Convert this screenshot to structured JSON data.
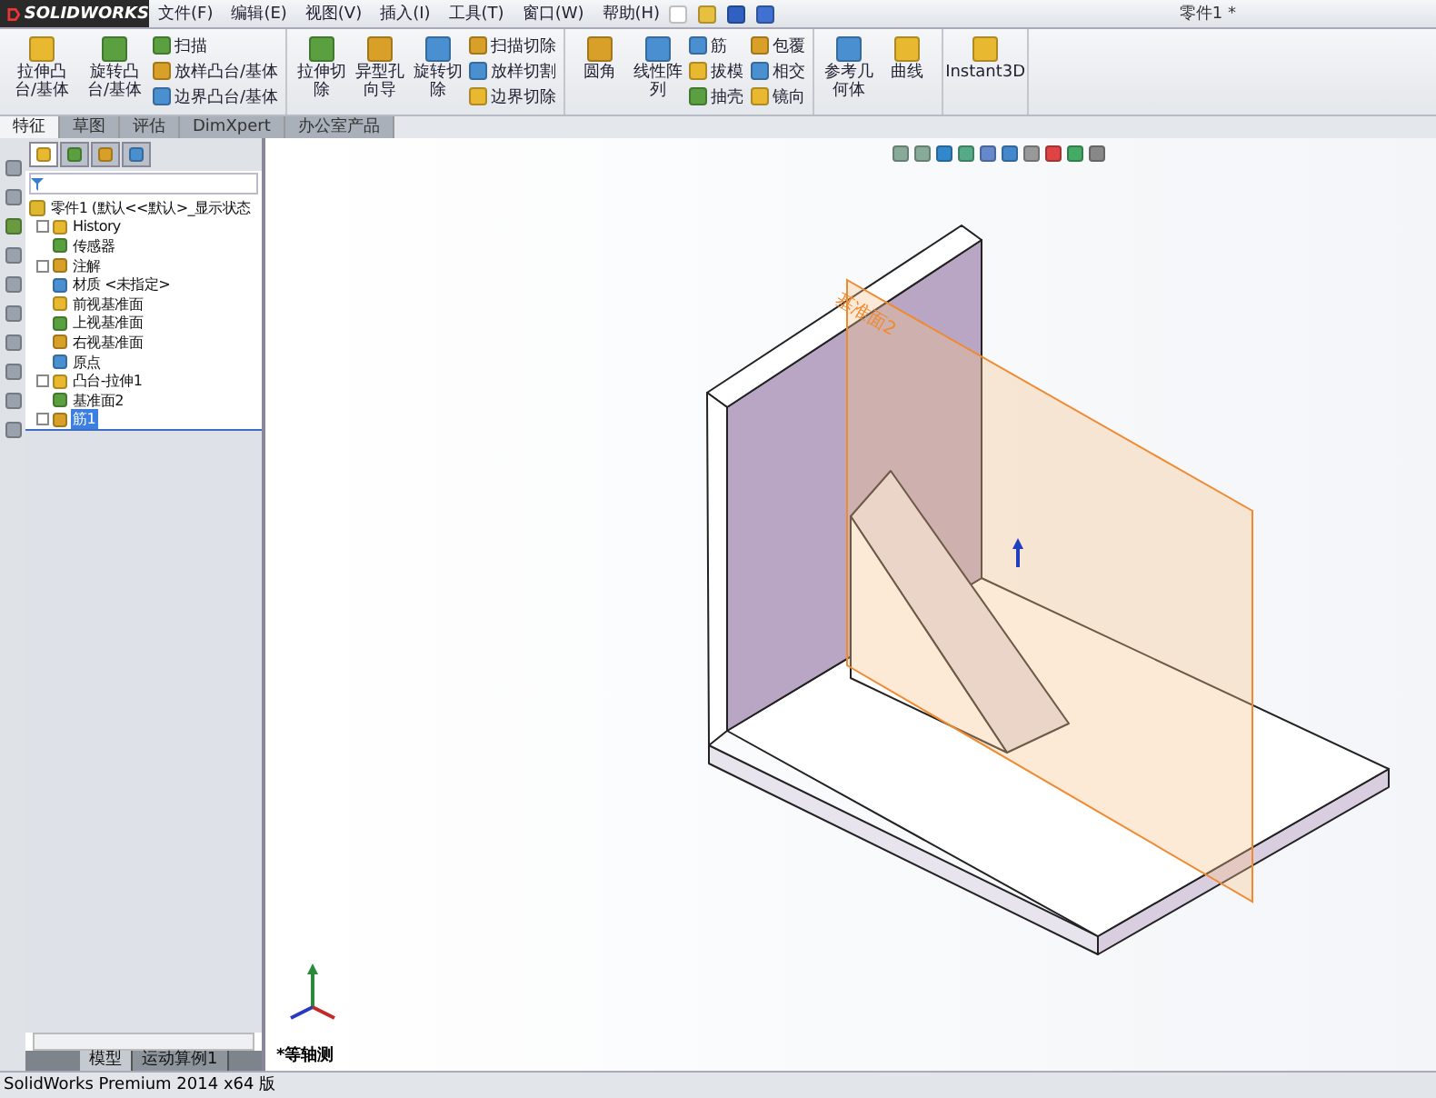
{
  "titlebar": {
    "logo": "SOLIDWORKS",
    "menus": [
      "文件(F)",
      "编辑(E)",
      "视图(V)",
      "插入(I)",
      "工具(T)",
      "窗口(W)",
      "帮助(H)"
    ],
    "document": "零件1 *"
  },
  "ribbon": {
    "groups": [
      {
        "large": [
          "拉伸凸台/基体",
          "旋转凸台/基体"
        ],
        "small": [
          "扫描",
          "放样凸台/基体",
          "边界凸台/基体"
        ]
      },
      {
        "large": [
          "拉伸切除",
          "异型孔向导",
          "旋转切除"
        ],
        "small": [
          "扫描切除",
          "放样切割",
          "边界切除"
        ]
      },
      {
        "large": [
          "圆角",
          "线性阵列"
        ],
        "small": [
          "筋",
          "拔模",
          "抽壳",
          "包覆",
          "相交",
          "镜向"
        ]
      },
      {
        "large": [
          "参考几何体",
          "曲线"
        ]
      },
      {
        "large": [
          "Instant3D"
        ]
      }
    ]
  },
  "tabs": [
    {
      "label": "特征",
      "selected": true
    },
    {
      "label": "草图",
      "selected": false
    },
    {
      "label": "评估",
      "selected": false
    },
    {
      "label": "DimXpert",
      "selected": false
    },
    {
      "label": "办公室产品",
      "selected": false
    }
  ],
  "pane_tabs": [
    {
      "selected": true
    },
    {
      "selected": false
    },
    {
      "selected": false
    },
    {
      "selected": false
    }
  ],
  "tree": {
    "root": "零件1 (默认<<默认>_显示状态",
    "items": [
      {
        "label": "History",
        "expandable": true,
        "selected": false
      },
      {
        "label": "传感器",
        "expandable": false,
        "selected": false
      },
      {
        "label": "注解",
        "expandable": true,
        "selected": false
      },
      {
        "label": "材质 <未指定>",
        "expandable": false,
        "selected": false
      },
      {
        "label": "前视基准面",
        "expandable": false,
        "selected": false
      },
      {
        "label": "上视基准面",
        "expandable": false,
        "selected": false
      },
      {
        "label": "右视基准面",
        "expandable": false,
        "selected": false
      },
      {
        "label": "原点",
        "expandable": false,
        "selected": false
      },
      {
        "label": "凸台-拉伸1",
        "expandable": true,
        "selected": false
      },
      {
        "label": "基准面2",
        "expandable": false,
        "selected": false
      },
      {
        "label": "筋1",
        "expandable": true,
        "selected": true
      }
    ]
  },
  "viewport": {
    "plane_label": "基准面2",
    "view_name": "*等轴测"
  },
  "bottom_tabs": [
    {
      "label": "模型",
      "selected": true
    },
    {
      "label": "运动算例1",
      "selected": false
    }
  ],
  "status_bar": "SolidWorks Premium 2014 x64 版"
}
